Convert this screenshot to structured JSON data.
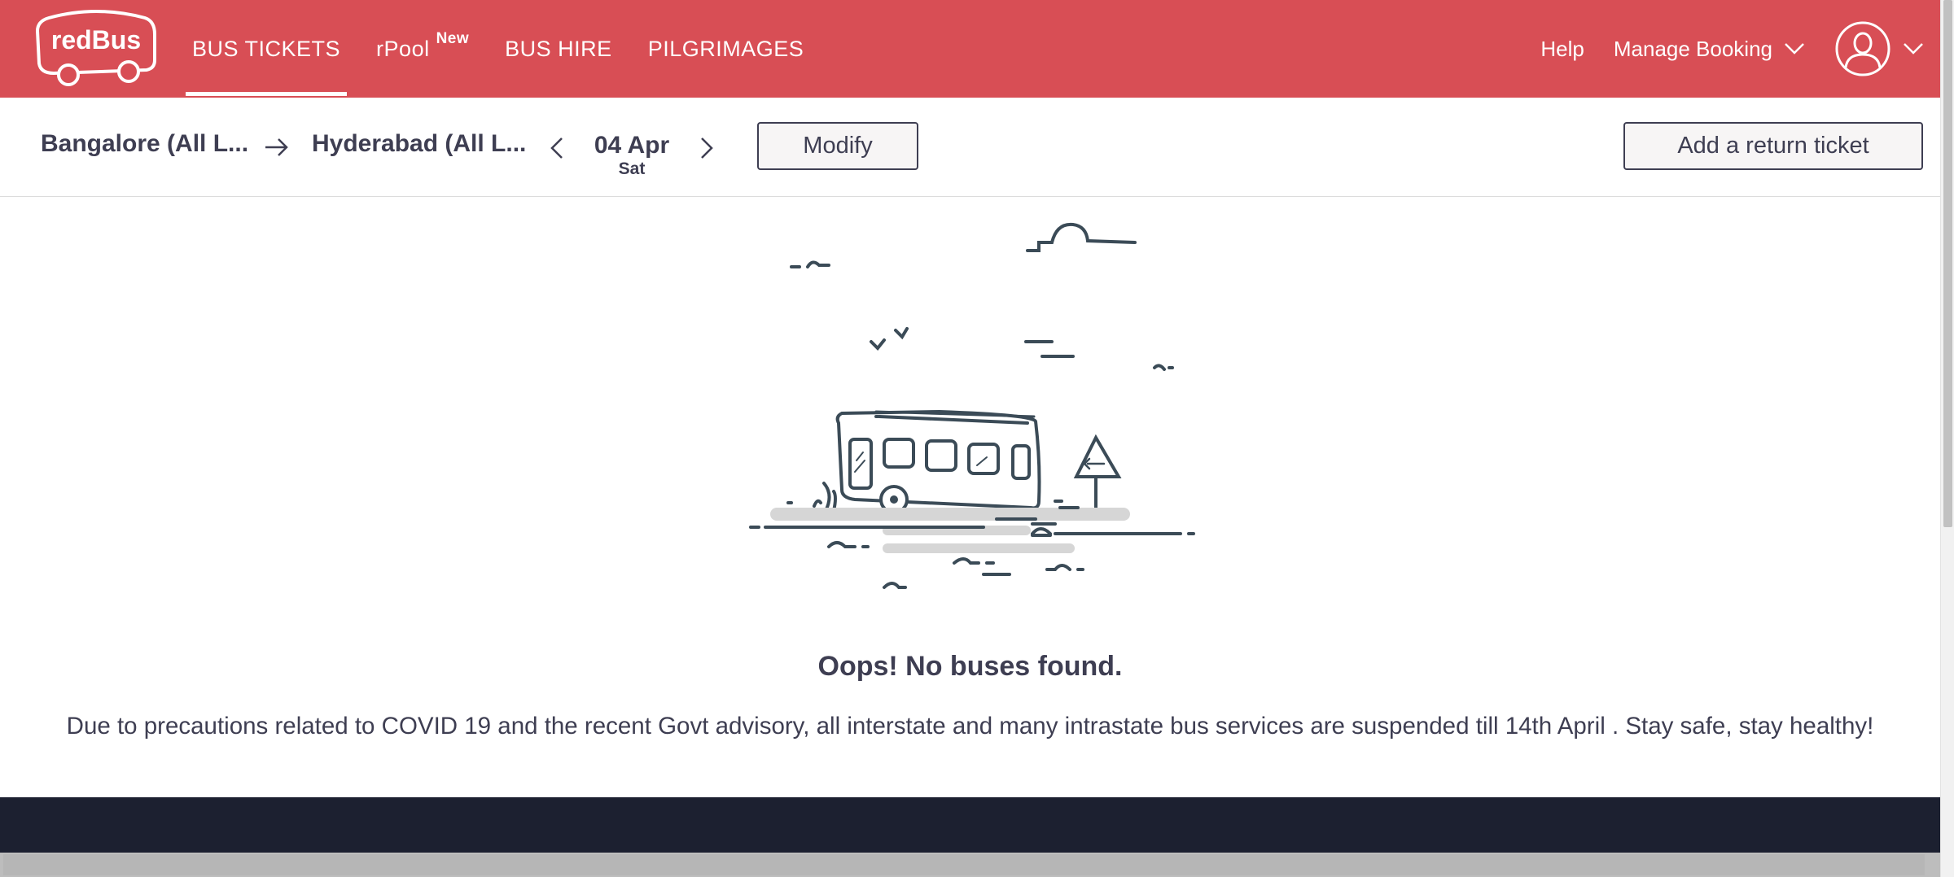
{
  "header": {
    "logo_text": "redBus",
    "nav": [
      {
        "label": "BUS TICKETS",
        "active": true
      },
      {
        "label": "rPool",
        "badge": "New"
      },
      {
        "label": "BUS HIRE"
      },
      {
        "label": "PILGRIMAGES"
      }
    ],
    "help_label": "Help",
    "manage_booking_label": "Manage Booking",
    "accent_color": "#d84e55"
  },
  "search": {
    "from_city": "Bangalore (All L...",
    "to_city": "Hyderabad (All L...",
    "date": "04 Apr",
    "day": "Sat",
    "modify_label": "Modify",
    "return_label": "Add a return ticket"
  },
  "result": {
    "title": "Oops! No buses found.",
    "message": "Due to precautions related to COVID 19 and the recent Govt advisory, all interstate and many intrastate bus services are suspended till 14th April . Stay safe, stay healthy!"
  },
  "icons": [
    "redbus-logo",
    "arrow-right-icon",
    "chevron-left-icon",
    "chevron-right-icon",
    "chevron-down-icon",
    "user-avatar-icon",
    "no-bus-illustration"
  ],
  "colors": {
    "footer": "#1c2030",
    "text": "#3e3e52"
  }
}
